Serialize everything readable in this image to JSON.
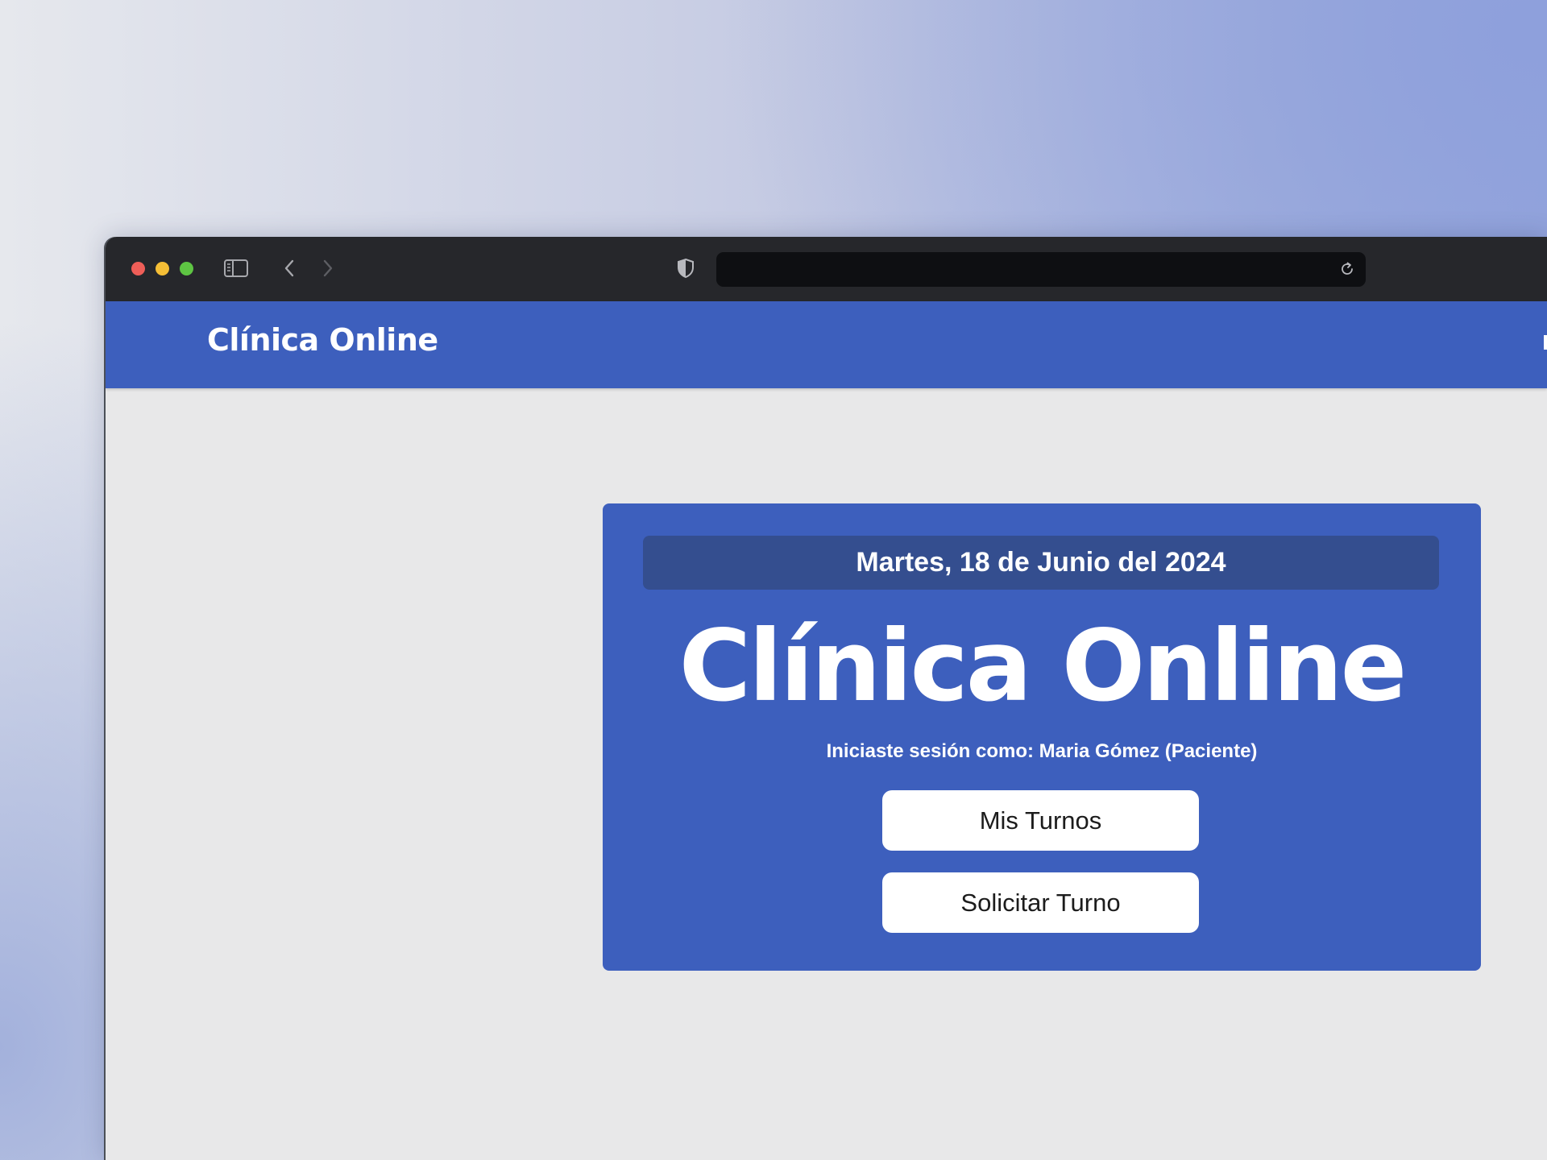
{
  "navbar": {
    "brand": "Clínica Online"
  },
  "card": {
    "date": "Martes, 18 de Junio del 2024",
    "title": "Clínica Online",
    "session_text": "Iniciaste sesión como: Maria Gómez (Paciente)",
    "buttons": {
      "mis_turnos": "Mis Turnos",
      "solicitar_turno": "Solicitar Turno"
    }
  },
  "icons": {
    "sidebar": "sidebar-toggle-icon",
    "back": "chevron-left-icon",
    "forward": "chevron-right-icon",
    "privacy": "shield-icon",
    "reload": "reload-icon"
  },
  "colors": {
    "primary_blue": "#3d5fbd",
    "date_bar": "#344e8f",
    "page_background": "#e8e8e9",
    "titlebar": "#26272b"
  }
}
